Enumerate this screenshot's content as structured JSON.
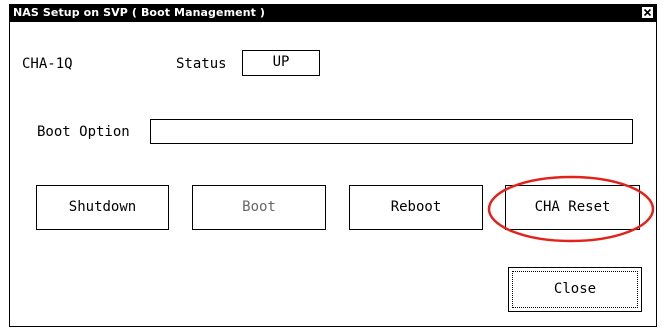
{
  "window": {
    "title": "NAS Setup on SVP ( Boot Management )"
  },
  "titlebar_close_icon": "close-icon",
  "device": {
    "name": "CHA-1Q",
    "status_label": "Status",
    "status_value": "UP"
  },
  "boot_option": {
    "label": "Boot Option",
    "value": ""
  },
  "actions": {
    "shutdown": "Shutdown",
    "boot": "Boot",
    "reboot": "Reboot",
    "cha_reset": "CHA Reset"
  },
  "footer": {
    "close": "Close"
  },
  "annotation": {
    "highlight_color": "#e2231a",
    "highlighted_item": "CHA Reset"
  }
}
